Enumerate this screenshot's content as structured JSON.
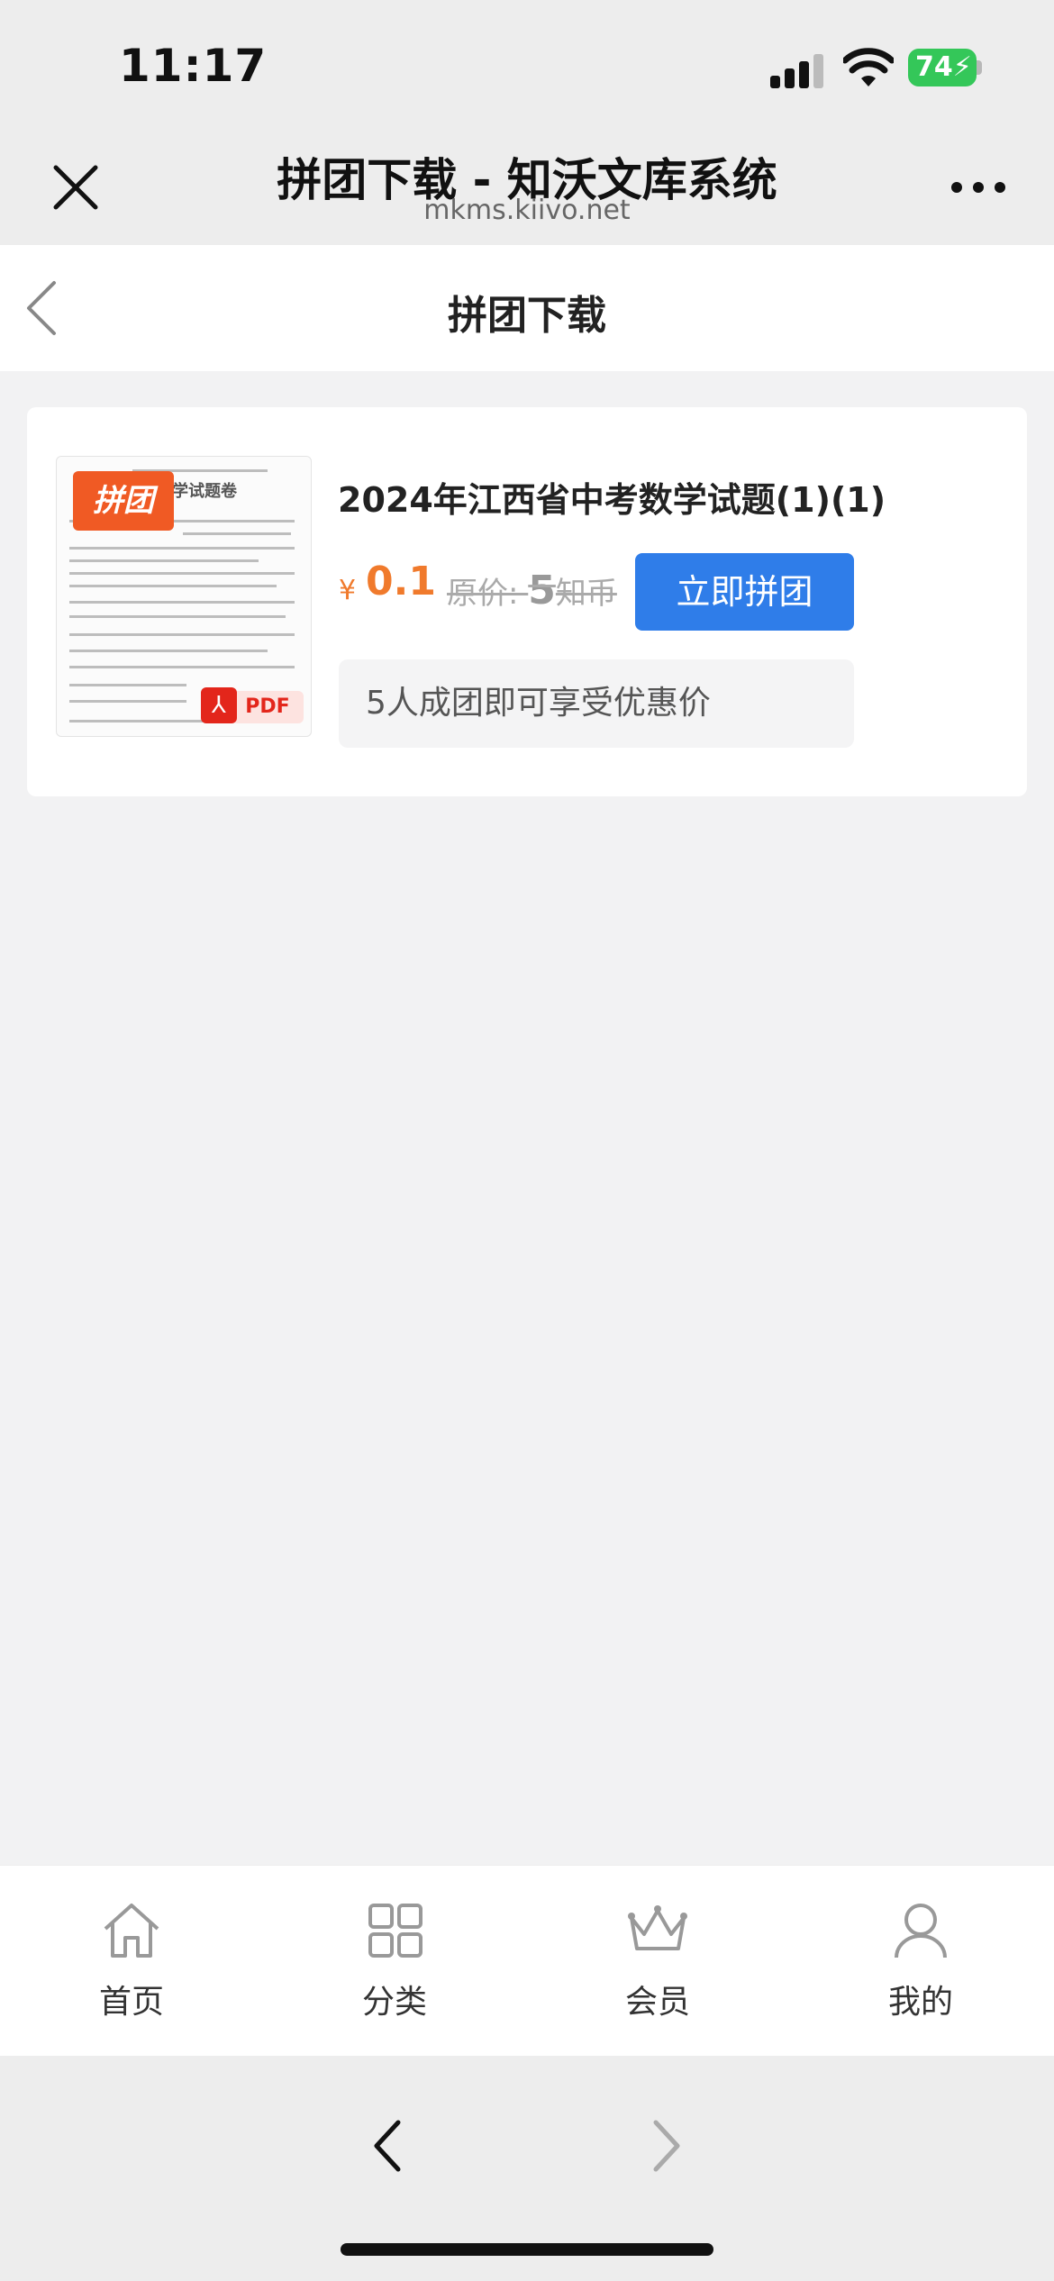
{
  "status_bar": {
    "time": "11:17",
    "battery_level": "74",
    "battery_charging": true
  },
  "wechat_nav": {
    "title": "拼团下载 - 知沃文库系统",
    "url": "mkms.kiivo.net",
    "close_icon": "close-icon",
    "more_icon": "more-icon"
  },
  "page_header": {
    "title": "拼团下载",
    "back_icon": "chevron-left-icon"
  },
  "product": {
    "badge": "拼团",
    "file_type": "PDF",
    "name": "2024年江西省中考数学试题(1)(1)",
    "currency_symbol": "¥",
    "price": "0.1",
    "original_prefix": "原价: ",
    "original_price": "5",
    "original_unit": "知币",
    "join_button": "立即拼团",
    "group_tip": "5人成团即可享受优惠价",
    "thumb_title": "数学试题卷"
  },
  "tabbar": {
    "items": [
      {
        "label": "首页",
        "icon": "home-icon"
      },
      {
        "label": "分类",
        "icon": "grid-icon"
      },
      {
        "label": "会员",
        "icon": "crown-icon"
      },
      {
        "label": "我的",
        "icon": "user-icon"
      }
    ]
  },
  "browser_bar": {
    "back_icon": "chevron-left-icon",
    "forward_icon": "chevron-right-icon"
  },
  "colors": {
    "accent_blue": "#2f7de9",
    "price_orange": "#f07a2c",
    "badge_orange": "#f05a24",
    "battery_green": "#34c759"
  }
}
